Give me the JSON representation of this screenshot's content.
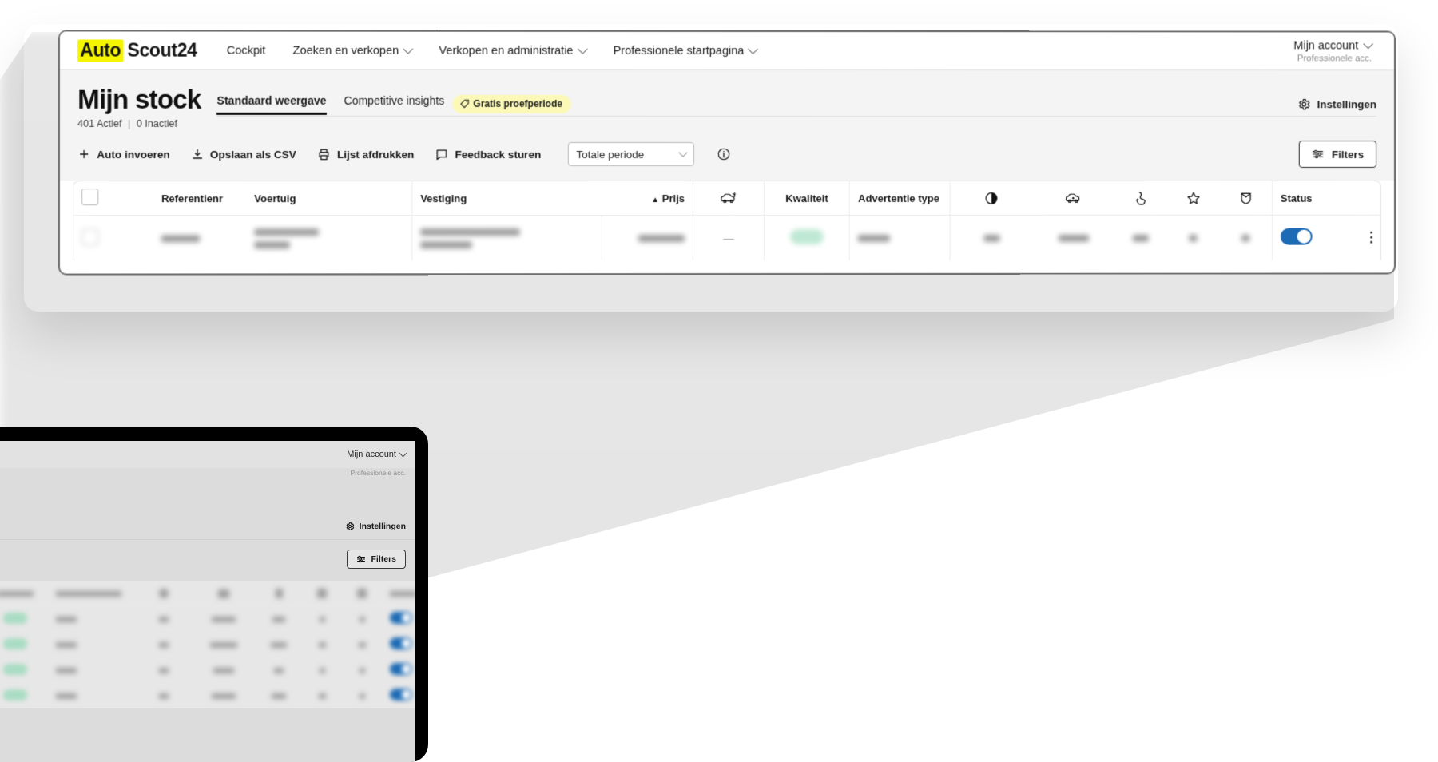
{
  "brand": {
    "logo_highlight": "Auto",
    "logo_rest": "Scout24",
    "highlight_color": "#f5f500"
  },
  "topnav": {
    "items": [
      {
        "label": "Cockpit",
        "has_caret": false
      },
      {
        "label": "Zoeken en verkopen",
        "has_caret": true
      },
      {
        "label": "Verkopen en administratie",
        "has_caret": true
      },
      {
        "label": "Professionele startpagina",
        "has_caret": true
      }
    ],
    "account": {
      "label": "Mijn account",
      "sublabel": "Professionele acc."
    }
  },
  "page": {
    "title": "Mijn stock",
    "active_count": "401 Actief",
    "separator": "|",
    "inactive_count": "0 Inactief",
    "tabs": [
      {
        "label": "Standaard weergave",
        "active": true
      },
      {
        "label": "Competitive insights",
        "active": false
      }
    ],
    "trial_badge": "Gratis proefperiode",
    "settings_label": "Instellingen"
  },
  "toolbar": {
    "actions": [
      {
        "label": "Auto invoeren",
        "icon": "plus-icon"
      },
      {
        "label": "Opslaan als CSV",
        "icon": "download-icon"
      },
      {
        "label": "Lijst afdrukken",
        "icon": "print-icon"
      },
      {
        "label": "Feedback sturen",
        "icon": "comment-icon"
      }
    ],
    "period_select": {
      "value": "Totale periode",
      "placeholder": "Totale periode"
    },
    "info_icon": "info-icon",
    "filters_label": "Filters"
  },
  "table": {
    "columns": [
      {
        "label": "",
        "icon": "checkbox-select-all",
        "key": "select"
      },
      {
        "label": "",
        "icon": "thumbnail",
        "key": "thumb"
      },
      {
        "label": "Referentienr",
        "key": "reference"
      },
      {
        "label": "Voertuig",
        "key": "vehicle"
      },
      {
        "label": "Vestiging",
        "key": "branch"
      },
      {
        "label": "Prijs",
        "key": "price",
        "sort": "asc",
        "sort_glyph": "▲"
      },
      {
        "label": "",
        "icon": "car-exchange-icon",
        "key": "trade"
      },
      {
        "label": "Kwaliteit",
        "key": "quality"
      },
      {
        "label": "Advertentie type",
        "key": "ad_type"
      },
      {
        "label": "",
        "icon": "pie-chart-icon",
        "key": "share"
      },
      {
        "label": "",
        "icon": "car-views-icon",
        "key": "views"
      },
      {
        "label": "",
        "icon": "click-cursor-icon",
        "key": "clicks"
      },
      {
        "label": "",
        "icon": "star-icon",
        "key": "favourites"
      },
      {
        "label": "",
        "icon": "mail-tag-icon",
        "key": "leads"
      },
      {
        "label": "Status",
        "key": "status"
      }
    ],
    "rows": [
      {
        "redacted": true,
        "quality_badge_color": "#bfe8d4",
        "status_toggle": "on",
        "toggle_color": "#1d6bb5",
        "menu_icon": "kebab-menu-icon"
      }
    ]
  },
  "tablet": {
    "account": {
      "label": "Mijn account",
      "sublabel": "Professionele acc."
    },
    "settings_label": "Instellingen",
    "filters_label": "Filters",
    "rows": [
      {
        "redacted": true
      },
      {
        "redacted": true
      },
      {
        "redacted": true
      },
      {
        "redacted": true
      }
    ]
  }
}
